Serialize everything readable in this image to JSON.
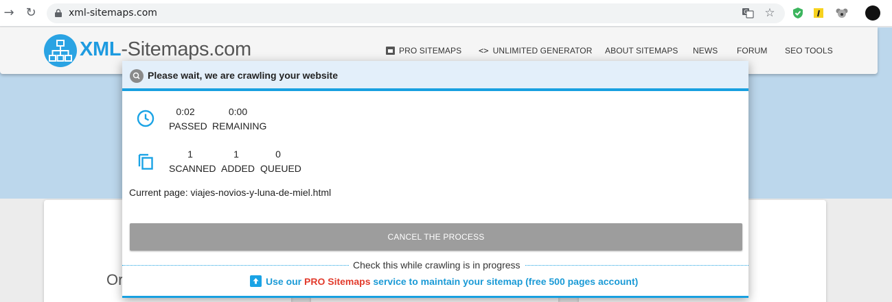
{
  "browser": {
    "url": "xml-sitemaps.com",
    "back_glyph": "→",
    "reload_glyph": "↻",
    "translate_icon": "translate-icon",
    "star_glyph": "☆"
  },
  "site": {
    "logo_bold": "XML",
    "logo_rest": "-Sitemaps.com",
    "nav": [
      {
        "label": "PRO SITEMAPS"
      },
      {
        "label": "UNLIMITED GENERATOR"
      },
      {
        "label": "ABOUT SITEMAPS"
      },
      {
        "label": "NEWS"
      },
      {
        "label": "FORUM"
      },
      {
        "label": "SEO TOOLS"
      }
    ],
    "partial_heading": "Or"
  },
  "modal": {
    "title": "Please wait, we are crawling your website",
    "time": {
      "passed_value": "0:02",
      "passed_label": "PASSED",
      "remaining_value": "0:00",
      "remaining_label": "REMAINING"
    },
    "pages": {
      "scanned_value": "1",
      "scanned_label": "SCANNED",
      "added_value": "1",
      "added_label": "ADDED",
      "queued_value": "0",
      "queued_label": "QUEUED"
    },
    "current_page": "Current page: viajes-novios-y-luna-de-miel.html",
    "cancel_label": "CANCEL THE PROCESS",
    "check_note": "Check this while crawling is in progress",
    "promo_before": "Use our ",
    "promo_pro": "PRO Sitemaps",
    "promo_after": " service to maintain your sitemap (free 500 pages account)"
  },
  "colors": {
    "accent": "#18a0e0",
    "pro_red": "#e23b2c",
    "button_grey": "#9d9d9d"
  }
}
